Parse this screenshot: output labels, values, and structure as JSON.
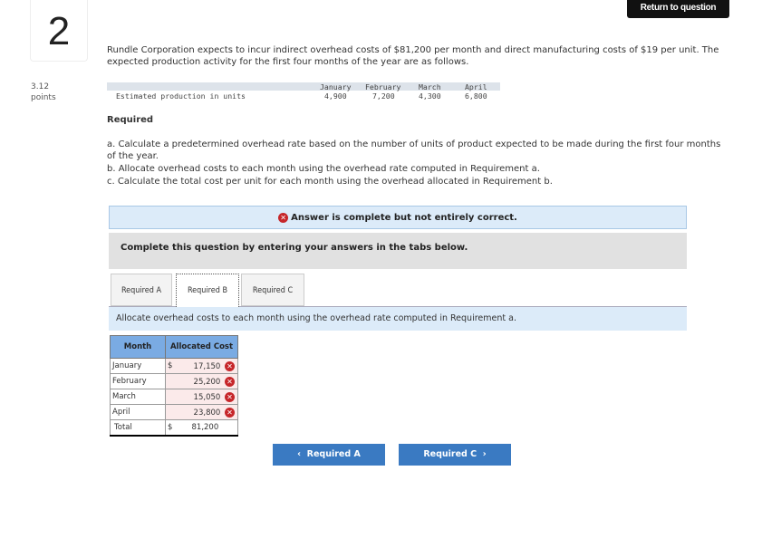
{
  "question_number": "2",
  "return_label": "Return to question",
  "points": {
    "value": "3.12",
    "label": "points"
  },
  "intro": "Rundle Corporation expects to incur indirect overhead costs of $81,200 per month and direct manufacturing costs of $19 per unit. The expected production activity for the first four months of the year are as follows.",
  "production": {
    "row_label": "Estimated production in units",
    "months": [
      "January",
      "February",
      "March",
      "April"
    ],
    "values": [
      "4,900",
      "7,200",
      "4,300",
      "6,800"
    ]
  },
  "required_heading": "Required",
  "requirements": [
    "a. Calculate a predetermined overhead rate based on the number of units of product expected to be made during the first four months of the year.",
    "b. Allocate overhead costs to each month using the overhead rate computed in Requirement a.",
    "c. Calculate the total cost per unit for each month using the overhead allocated in Requirement b."
  ],
  "status": "Answer is complete but not entirely correct.",
  "instruction": "Complete this question by entering your answers in the tabs below.",
  "tabs": [
    "Required A",
    "Required B",
    "Required C"
  ],
  "active_tab": "Required B",
  "tab_description": "Allocate overhead costs to each month using the overhead rate computed in Requirement a.",
  "table": {
    "headers": [
      "Month",
      "Allocated Cost"
    ],
    "rows": [
      {
        "month": "January",
        "dollar": "$",
        "value": "17,150",
        "status": "incorrect"
      },
      {
        "month": "February",
        "dollar": "",
        "value": "25,200",
        "status": "incorrect"
      },
      {
        "month": "March",
        "dollar": "",
        "value": "15,050",
        "status": "incorrect"
      },
      {
        "month": "April",
        "dollar": "",
        "value": "23,800",
        "status": "incorrect"
      }
    ],
    "total": {
      "label": "Total",
      "dollar": "$",
      "value": "81,200"
    }
  },
  "nav": {
    "prev": "Required A",
    "next": "Required C"
  },
  "colors": {
    "accent": "#3a7ac2",
    "error": "#c6262a",
    "header": "#7aabe3"
  }
}
